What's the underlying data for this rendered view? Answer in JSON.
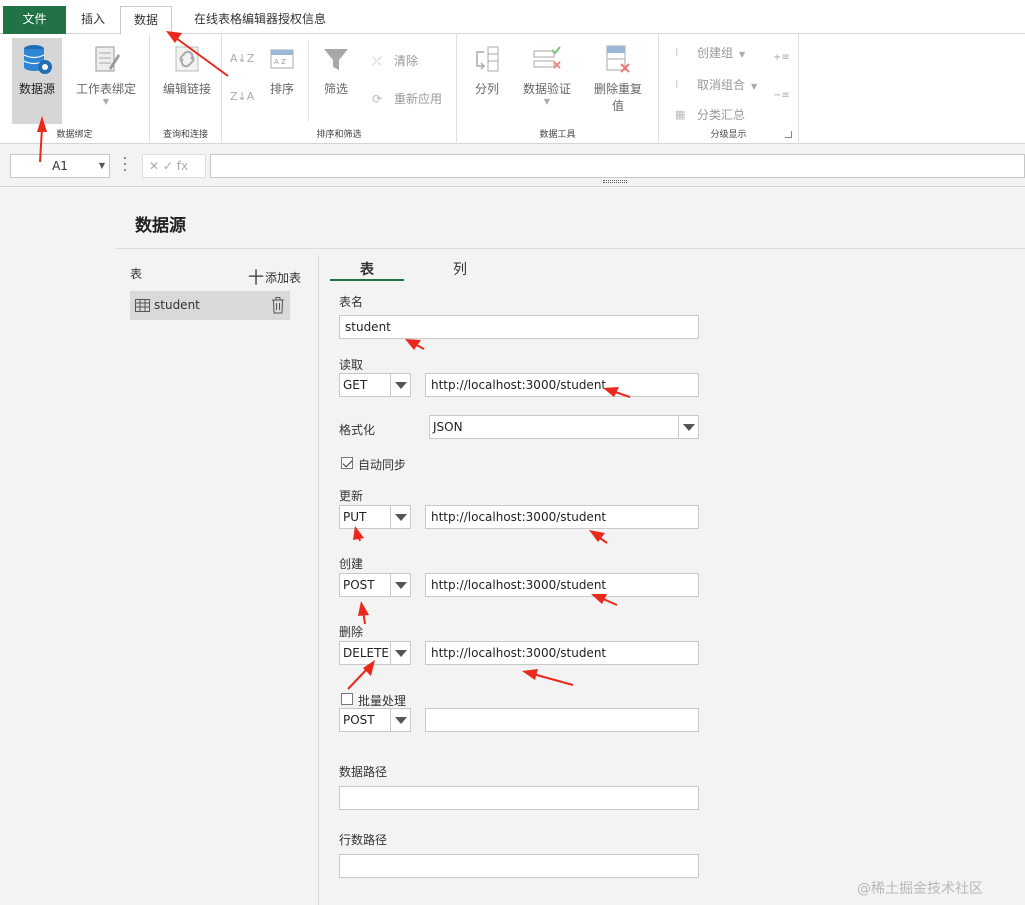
{
  "tabs": [
    {
      "label": "文件"
    },
    {
      "label": "插入"
    },
    {
      "label": "数据"
    },
    {
      "label": "在线表格编辑器授权信息"
    }
  ],
  "ribbon": {
    "datasource": "数据源",
    "sheet_binding": "工作表绑定",
    "group_binding": "数据绑定",
    "edit_link": "编辑链接",
    "group_query": "查询和连接",
    "sort": "排序",
    "filter": "筛选",
    "clear": "清除",
    "reapply": "重新应用",
    "group_sort": "排序和筛选",
    "split_columns": "分列",
    "data_validation": "数据验证",
    "remove_dup_1": "删除重复",
    "remove_dup_2": "值",
    "group_tools": "数据工具",
    "create_group": "创建组",
    "ungroup": "取消组合",
    "subtotal": "分类汇总",
    "group_outline": "分级显示"
  },
  "formula_bar": {
    "cell_ref": "A1",
    "fx_symbols": "✕ ✓ fx"
  },
  "panel": {
    "title": "数据源",
    "tables_label": "表",
    "add_table": "添加表",
    "add_table_plus": "十",
    "table_name_item": "student",
    "tab_table": "表",
    "tab_columns": "列",
    "label_table_name": "表名",
    "table_name_value": "student",
    "label_read": "读取",
    "read_method": "GET",
    "read_url": "http://localhost:3000/student",
    "label_format": "格式化",
    "format_value": "JSON",
    "auto_sync_label": "自动同步",
    "auto_sync_checked": true,
    "label_update": "更新",
    "update_method": "PUT",
    "update_url": "http://localhost:3000/student",
    "label_create": "创建",
    "create_method": "POST",
    "create_url": "http://localhost:3000/student",
    "label_delete": "删除",
    "delete_method": "DELETE",
    "delete_url": "http://localhost:3000/student",
    "batch_label": "批量处理",
    "batch_checked": false,
    "batch_method": "POST",
    "batch_url": "",
    "label_data_path": "数据路径",
    "data_path_value": "",
    "label_count_path": "行数路径",
    "count_path_value": ""
  },
  "watermark": "@稀土掘金技术社区",
  "colors": {
    "accent": "#217346",
    "annotation_arrow": "#e8291c"
  }
}
